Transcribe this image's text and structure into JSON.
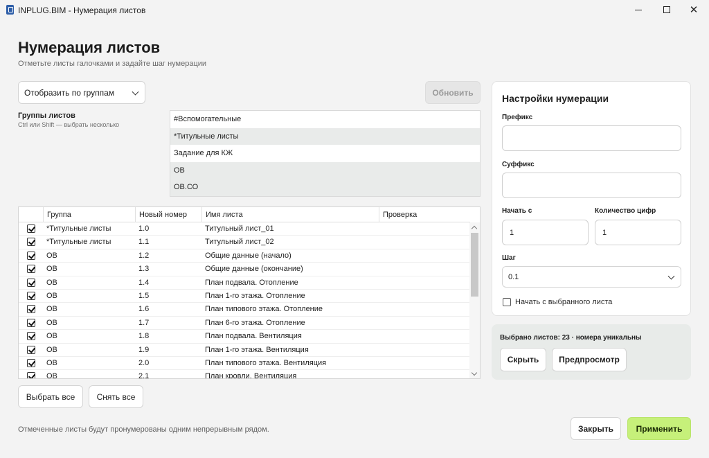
{
  "window": {
    "title": "INPLUG.BIM - Нумерация листов",
    "controls": [
      "minimize-icon",
      "maximize-icon",
      "close-icon"
    ]
  },
  "header": {
    "title": "Нумерация листов",
    "subtitle": "Отметьте листы галочками и задайте шаг нумерации"
  },
  "toolbar": {
    "view_mode": "Отобразить по группам",
    "refresh_label": "Обновить"
  },
  "groups": {
    "label": "Группы листов",
    "hint": "Ctrl или Shift — выбрать несколько",
    "items": [
      {
        "label": "#Вспомогательные",
        "selected": false
      },
      {
        "label": "*Титульные листы",
        "selected": true
      },
      {
        "label": "Задание для КЖ",
        "selected": false
      },
      {
        "label": "ОВ",
        "selected": true
      },
      {
        "label": "ОВ.СО",
        "selected": true
      }
    ]
  },
  "table": {
    "columns": [
      "Группа",
      "Новый номер",
      "Имя листа",
      "Проверка"
    ],
    "rows": [
      {
        "checked": true,
        "group": "*Титульные листы",
        "number": "1.0",
        "name": "Титульный лист_01",
        "check": ""
      },
      {
        "checked": true,
        "group": "*Титульные листы",
        "number": "1.1",
        "name": "Титульный лист_02",
        "check": ""
      },
      {
        "checked": true,
        "group": "ОВ",
        "number": "1.2",
        "name": "Общие данные (начало)",
        "check": ""
      },
      {
        "checked": true,
        "group": "ОВ",
        "number": "1.3",
        "name": "Общие данные (окончание)",
        "check": ""
      },
      {
        "checked": true,
        "group": "ОВ",
        "number": "1.4",
        "name": "План подвала. Отопление",
        "check": ""
      },
      {
        "checked": true,
        "group": "ОВ",
        "number": "1.5",
        "name": "План 1-го этажа. Отопление",
        "check": ""
      },
      {
        "checked": true,
        "group": "ОВ",
        "number": "1.6",
        "name": "План типового этажа. Отопление",
        "check": ""
      },
      {
        "checked": true,
        "group": "ОВ",
        "number": "1.7",
        "name": "План 6-го этажа. Отопление",
        "check": ""
      },
      {
        "checked": true,
        "group": "ОВ",
        "number": "1.8",
        "name": "План подвала. Вентиляция",
        "check": ""
      },
      {
        "checked": true,
        "group": "ОВ",
        "number": "1.9",
        "name": "План 1-го этажа. Вентиляция",
        "check": ""
      },
      {
        "checked": true,
        "group": "ОВ",
        "number": "2.0",
        "name": "План типового этажа. Вентиляция",
        "check": ""
      },
      {
        "checked": true,
        "group": "ОВ",
        "number": "2.1",
        "name": "План кровли. Вентиляция",
        "check": ""
      }
    ]
  },
  "selection_buttons": {
    "select_all": "Выбрать все",
    "deselect_all": "Снять все"
  },
  "footer": {
    "note": "Отмеченные листы будут пронумерованы одним непрерывным рядом.",
    "close_label": "Закрыть",
    "apply_label": "Применить"
  },
  "settings": {
    "title": "Настройки нумерации",
    "prefix_label": "Префикс",
    "prefix_value": "",
    "suffix_label": "Суффикс",
    "suffix_value": "",
    "start_label": "Начать с",
    "start_value": "1",
    "digits_label": "Количество цифр",
    "digits_value": "1",
    "step_label": "Шаг",
    "step_value": "0.1",
    "from_selected_label": "Начать с выбранного листа",
    "from_selected_checked": false
  },
  "status": {
    "text": "Выбрано листов: 23 · номера уникальны",
    "hide_label": "Скрыть",
    "preview_label": "Предпросмотр"
  },
  "colors": {
    "accent_green": "#c6f07a",
    "selected_row": "#e9ebea"
  }
}
